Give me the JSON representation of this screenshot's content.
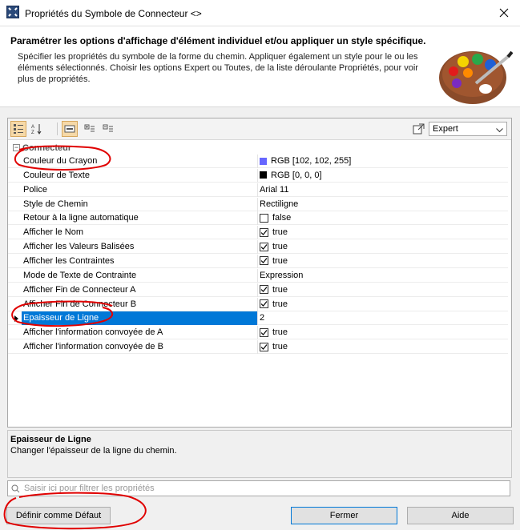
{
  "window": {
    "title": "Propriétés du Symbole de Connecteur <>"
  },
  "header": {
    "title": "Paramétrer les options d'affichage d'élément individuel et/ou appliquer un style spécifique.",
    "description": "Spécifier les propriétés du symbole de la forme du chemin. Appliquer également un style pour le ou les éléments sélectionnés. Choisir les options Expert ou Toutes, de la liste déroulante Propriétés, pour voir plus de propriétés."
  },
  "toolbar": {
    "mode_selected": "Expert"
  },
  "group": {
    "label": "Connecteur"
  },
  "rows": [
    {
      "name": "Couleur du Crayon",
      "value": "RGB [102, 102, 255]",
      "type": "color",
      "color": "#6666ff"
    },
    {
      "name": "Couleur de Texte",
      "value": "RGB [0, 0, 0]",
      "type": "color",
      "color": "#000000"
    },
    {
      "name": "Police",
      "value": "Arial 11",
      "type": "text"
    },
    {
      "name": "Style de Chemin",
      "value": "Rectiligne",
      "type": "text"
    },
    {
      "name": "Retour à la ligne automatique",
      "value": "false",
      "type": "check",
      "checked": false
    },
    {
      "name": "Afficher le Nom",
      "value": "true",
      "type": "check",
      "checked": true
    },
    {
      "name": "Afficher les Valeurs Balisées",
      "value": "true",
      "type": "check",
      "checked": true
    },
    {
      "name": "Afficher les Contraintes",
      "value": "true",
      "type": "check",
      "checked": true
    },
    {
      "name": "Mode de Texte de Contrainte",
      "value": "Expression",
      "type": "text"
    },
    {
      "name": "Afficher Fin de Connecteur A",
      "value": "true",
      "type": "check",
      "checked": true
    },
    {
      "name": "Afficher Fin de Connecteur B",
      "value": "true",
      "type": "check",
      "checked": true
    },
    {
      "name": "Epaisseur de Ligne",
      "value": "2",
      "type": "text",
      "selected": true
    },
    {
      "name": "Afficher l'information convoyée de A",
      "value": "true",
      "type": "check",
      "checked": true
    },
    {
      "name": "Afficher l'information convoyée de B",
      "value": "true",
      "type": "check",
      "checked": true
    }
  ],
  "description_pane": {
    "title": "Epaisseur de Ligne",
    "text": "Changer l'épaisseur de la ligne du chemin."
  },
  "filter": {
    "placeholder": "Saisir ici pour filtrer les propriétés"
  },
  "buttons": {
    "default_label": "Définir comme Défaut",
    "close_label": "Fermer",
    "help_label": "Aide"
  },
  "colors": {
    "selection": "#0078d7",
    "annotation": "#e00000"
  }
}
